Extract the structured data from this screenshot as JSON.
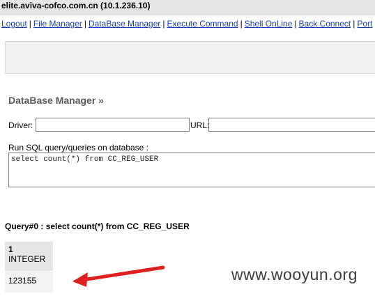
{
  "header": {
    "host": "elite.aviva-cofco.com.cn (10.1.236.10)"
  },
  "nav": {
    "items": [
      "Logout",
      "File Manager",
      "DataBase Manager",
      "Execute Command",
      "Shell OnLine",
      "Back Connect",
      "Port"
    ],
    "separator": "|"
  },
  "db_manager": {
    "title": "DataBase Manager »",
    "driver_label": "Driver:",
    "driver_value": "",
    "url_label": "URL:",
    "url_value": "",
    "sql_label": "Run SQL query/queries on database :",
    "sql_value": "select count(*) from CC_REG_USER"
  },
  "result": {
    "query_title": "Query#0 : select count(*) from CC_REG_USER",
    "columns": [
      {
        "name": "1",
        "type": "INTEGER"
      }
    ],
    "rows": [
      [
        "123155"
      ]
    ]
  },
  "annotation": {
    "arrow_color": "#e0201f"
  },
  "watermark": "www.wooyun.org"
}
